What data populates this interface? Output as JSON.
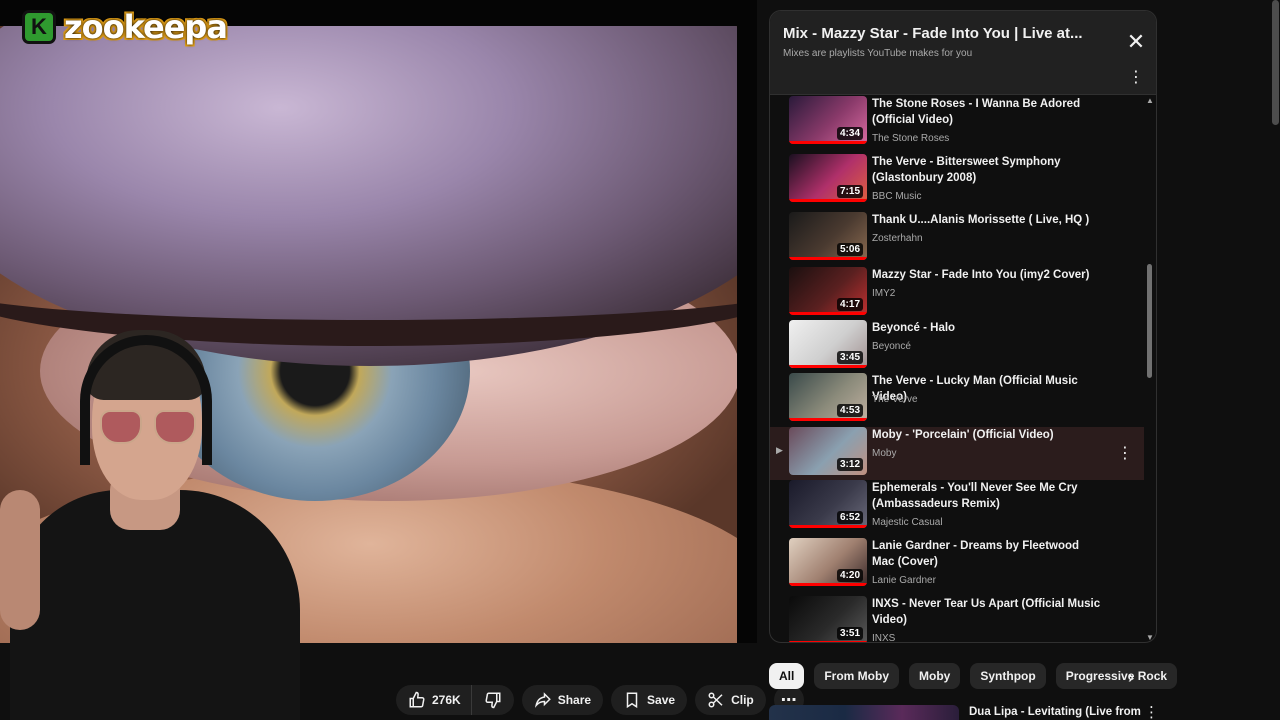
{
  "logo": {
    "icon_letter": "K",
    "text": "zookeepa"
  },
  "actions": {
    "like_count": "276K",
    "share_label": "Share",
    "save_label": "Save",
    "clip_label": "Clip",
    "more_label": "⋯"
  },
  "playlist": {
    "title": "Mix - Mazzy Star - Fade Into You | Live at...",
    "subtitle": "Mixes are playlists YouTube makes for you",
    "items": [
      {
        "title": "The Stone Roses - I Wanna Be Adored (Official Video)",
        "channel": "The Stone Roses",
        "duration": "4:34",
        "colors": [
          "#2a1a3a",
          "#8a3a6a",
          "#d86aa0"
        ]
      },
      {
        "title": "The Verve - Bittersweet Symphony (Glastonbury 2008)",
        "channel": "BBC Music",
        "duration": "7:15",
        "colors": [
          "#1a1020",
          "#b0306a",
          "#e06040"
        ]
      },
      {
        "title": "Thank U....Alanis Morissette ( Live, HQ )",
        "channel": "Zosterhahn",
        "duration": "5:06",
        "colors": [
          "#1a1a1a",
          "#4a3a30",
          "#8a6a50"
        ]
      },
      {
        "title": "Mazzy Star - Fade Into You (imy2 Cover)",
        "channel": "IMY2",
        "duration": "4:17",
        "colors": [
          "#1a0f0f",
          "#5a2020",
          "#c03030"
        ]
      },
      {
        "title": "Beyoncé - Halo",
        "channel": "Beyoncé",
        "duration": "3:45",
        "colors": [
          "#f0f0f0",
          "#cfcfcf",
          "#a09090"
        ]
      },
      {
        "title": "The Verve - Lucky Man (Official Music Video)",
        "channel": "The Verve",
        "duration": "4:53",
        "colors": [
          "#3a4a4a",
          "#8a8a7a",
          "#c0b0a0"
        ]
      },
      {
        "title": "Moby - 'Porcelain' (Official Video)",
        "channel": "Moby",
        "duration": "3:12",
        "colors": [
          "#6a4a5a",
          "#8aa0b0",
          "#c09080"
        ],
        "active": true
      },
      {
        "title": "Ephemerals - You'll Never See Me Cry (Ambassadeurs Remix)",
        "channel": "Majestic Casual",
        "duration": "6:52",
        "colors": [
          "#1a1a2a",
          "#3a3a4a",
          "#6a6a7a"
        ]
      },
      {
        "title": "Lanie Gardner - Dreams by Fleetwood Mac (Cover)",
        "channel": "Lanie Gardner",
        "duration": "4:20",
        "colors": [
          "#e0d0c0",
          "#a08070",
          "#3a2a2a"
        ]
      },
      {
        "title": "INXS - Never Tear Us Apart (Official Music Video)",
        "channel": "INXS",
        "duration": "3:51",
        "colors": [
          "#0a0a0a",
          "#2a2a2a",
          "#5a5a5a"
        ]
      }
    ]
  },
  "chips": [
    "All",
    "From Moby",
    "Moby",
    "Synthpop",
    "Progressive Rock"
  ],
  "next_video": {
    "title": "Dua Lipa - Levitating (Live from"
  }
}
